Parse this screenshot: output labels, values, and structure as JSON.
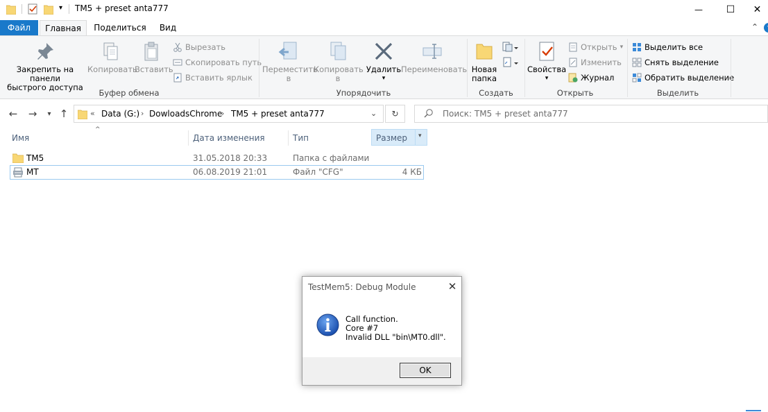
{
  "window": {
    "title": "TM5 + preset anta777",
    "controls": {
      "minimize": "—",
      "maximize": "☐",
      "close": "✕"
    }
  },
  "tabs": {
    "file": "Файл",
    "home": "Главная",
    "share": "Поделиться",
    "view": "Вид"
  },
  "ribbon": {
    "clipboard": {
      "pin_line1": "Закрепить на панели",
      "pin_line2": "быстрого доступа",
      "copy": "Копировать",
      "paste": "Вставить",
      "cut": "Вырезать",
      "copy_path": "Скопировать путь",
      "paste_shortcut": "Вставить ярлык",
      "label": "Буфер обмена"
    },
    "organize": {
      "move_line1": "Переместить",
      "move_line2": "в",
      "copy_line1": "Копировать",
      "copy_line2": "в",
      "delete": "Удалить",
      "rename": "Переименовать",
      "label": "Упорядочить"
    },
    "new": {
      "folder_line1": "Новая",
      "folder_line2": "папка",
      "label": "Создать"
    },
    "open": {
      "properties": "Свойства",
      "open": "Открыть",
      "edit": "Изменить",
      "history": "Журнал",
      "label": "Открыть"
    },
    "select": {
      "select_all": "Выделить все",
      "select_none": "Снять выделение",
      "invert": "Обратить выделение",
      "label": "Выделить"
    }
  },
  "address": {
    "overflow": "«",
    "crumbs": [
      "Data (G:)",
      "DowloadsChrome",
      "TM5 + preset anta777"
    ],
    "search_placeholder": "Поиск: TM5 + preset anta777"
  },
  "columns": {
    "name": "Имя",
    "date": "Дата изменения",
    "type": "Тип",
    "size": "Размер"
  },
  "files": [
    {
      "name": "TM5",
      "date": "31.05.2018 20:33",
      "type": "Папка с файлами",
      "size": ""
    },
    {
      "name": "MT",
      "date": "06.08.2019 21:01",
      "type": "Файл \"CFG\"",
      "size": "4 КБ"
    }
  ],
  "dialog": {
    "title": "TestMem5: Debug Module",
    "line1": "Call function.",
    "line2": "Core #7",
    "line3": "Invalid DLL  \"bin\\MT0.dll\".",
    "ok": "OK"
  },
  "colors": {
    "accent": "#1979ca",
    "folder": "#f8d775",
    "info_icon": "#1f5fbf",
    "selection_border": "#99c9ef",
    "size_header_bg": "#d9ebf9"
  }
}
